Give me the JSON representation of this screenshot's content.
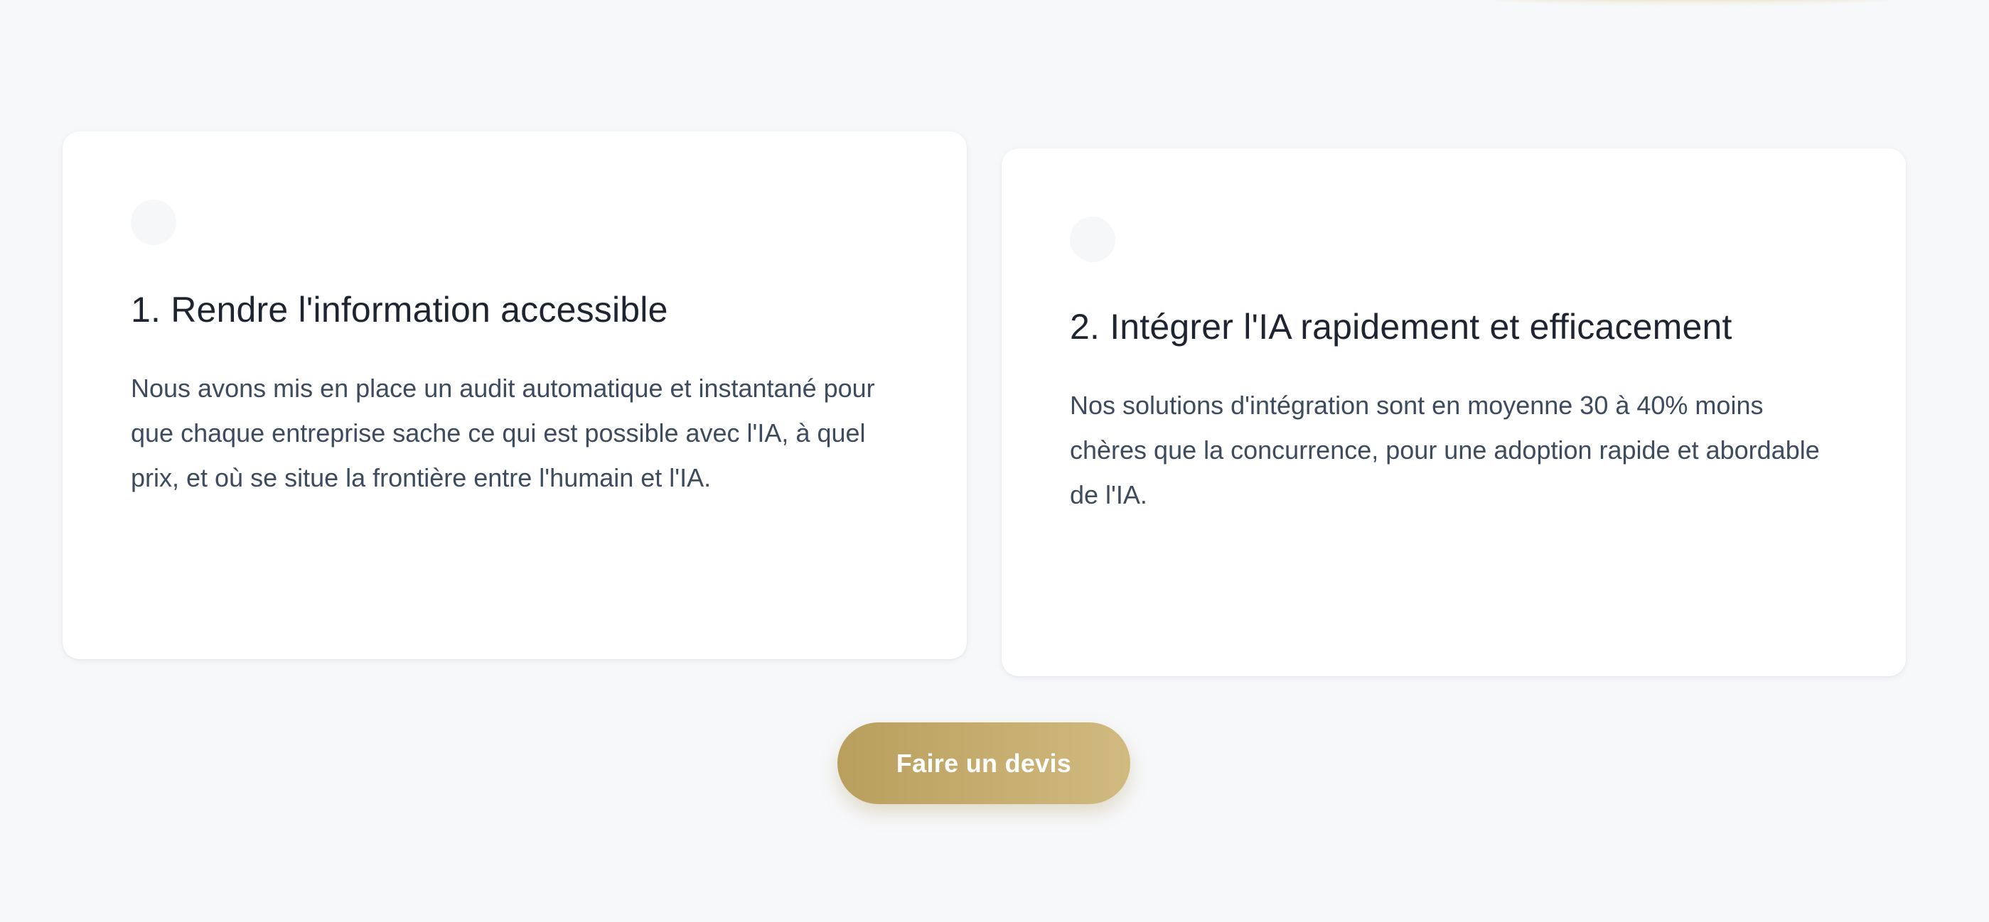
{
  "cards": [
    {
      "title": "1. Rendre l'information accessible",
      "text": "Nous avons mis en place un audit automatique et instantané pour que chaque entreprise sache ce qui est possible avec l'IA, à quel prix, et où se situe la frontière entre l'humain et l'IA."
    },
    {
      "title": "2. Intégrer l'IA rapidement et efficacement",
      "text": "Nos solutions d'intégration sont en moyenne 30 à 40% moins chères que la concurrence, pour une adoption rapide et abordable de l'IA."
    }
  ],
  "cta": {
    "label": "Faire un devis"
  },
  "colors": {
    "background": "#f7f8fa",
    "card": "#ffffff",
    "title": "#1f2530",
    "body_text": "#3e4b5e",
    "button_gradient_start": "#b99f5d",
    "button_gradient_end": "#d1ba80",
    "button_text": "#ffffff"
  }
}
